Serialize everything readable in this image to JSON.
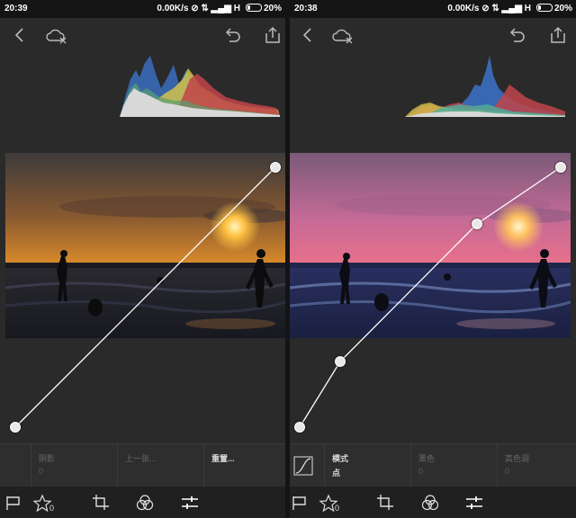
{
  "left": {
    "status": {
      "time": "20:39",
      "network": "0.00K/s",
      "signal": "H",
      "battery": "20%"
    },
    "icons": {
      "back": "back-icon",
      "cloud": "cloud-off-icon",
      "undo": "undo-icon",
      "share": "share-icon"
    },
    "controls": [
      {
        "label": "阴影",
        "value": "0"
      },
      {
        "label": "上一张...",
        "value": ""
      },
      {
        "label": "重置...",
        "value": ""
      }
    ],
    "rating": "0"
  },
  "right": {
    "status": {
      "time": "20:38",
      "network": "0.00K/s",
      "signal": "H",
      "battery": "20%"
    },
    "icons": {
      "back": "back-icon",
      "cloud": "cloud-off-icon",
      "undo": "undo-icon",
      "share": "share-icon"
    },
    "mode": {
      "label": "模式",
      "value": "点"
    },
    "controls": [
      {
        "label": "黑色",
        "value": "0"
      },
      {
        "label": "高色调",
        "value": "0"
      }
    ],
    "rating": "0"
  },
  "colors": {
    "background": "#2a2a2a",
    "statusbar": "#141414",
    "accent": "#ffffff"
  }
}
